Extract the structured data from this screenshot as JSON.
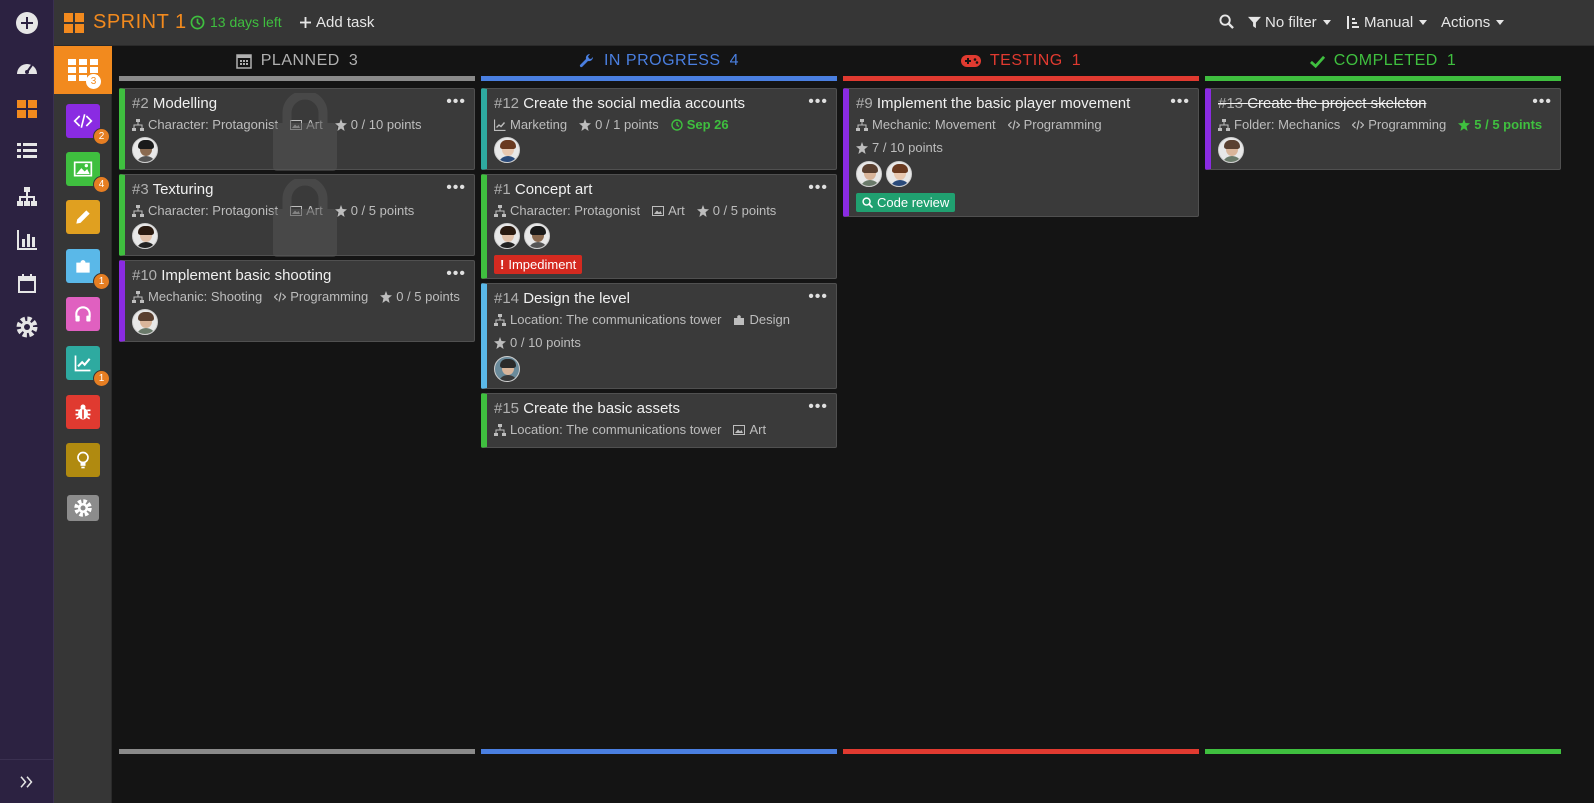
{
  "sprint": {
    "title": "SPRINT 1",
    "days_left": "13 days left",
    "add_task": "Add task"
  },
  "toolbar": {
    "filter": "No filter",
    "sort": "Manual",
    "actions": "Actions"
  },
  "project_badges": {
    "board": "3",
    "code": "2",
    "art": "4",
    "puzzle": "1",
    "chart": "1"
  },
  "columns": [
    {
      "label": "PLANNED",
      "count": "3",
      "color": "#8a8a8a"
    },
    {
      "label": "IN PROGRESS",
      "count": "4",
      "color": "#4a7fe0"
    },
    {
      "label": "TESTING",
      "count": "1",
      "color": "#e03a30"
    },
    {
      "label": "COMPLETED",
      "count": "1",
      "color": "#3fbf3f"
    }
  ],
  "cards": {
    "c2": {
      "num": "#2",
      "title": "Modelling",
      "category": "Character: Protagonist",
      "type": "Art",
      "points": "0 / 10 points",
      "color": "#3fbf3f"
    },
    "c3": {
      "num": "#3",
      "title": "Texturing",
      "category": "Character: Protagonist",
      "type": "Art",
      "points": "0 / 5 points",
      "color": "#3fbf3f"
    },
    "c10": {
      "num": "#10",
      "title": "Implement basic shooting",
      "category": "Mechanic: Shooting",
      "type": "Programming",
      "points": "0 / 5 points",
      "color": "#8a2be2"
    },
    "c12": {
      "num": "#12",
      "title": "Create the social media accounts",
      "type": "Marketing",
      "points": "0 / 1 points",
      "due": "Sep 26",
      "color": "#2eaaa0"
    },
    "c1": {
      "num": "#1",
      "title": "Concept art",
      "category": "Character: Protagonist",
      "type": "Art",
      "points": "0 / 5 points",
      "tag": "Impediment",
      "color": "#3fbf3f"
    },
    "c14": {
      "num": "#14",
      "title": "Design the level",
      "category": "Location: The communications tower",
      "type": "Design",
      "points": "0 / 10 points",
      "color": "#5ab8e8"
    },
    "c15": {
      "num": "#15",
      "title": "Create the basic assets",
      "category": "Location: The communications tower",
      "type": "Art",
      "color": "#3fbf3f"
    },
    "c9": {
      "num": "#9",
      "title": "Implement the basic player movement",
      "category": "Mechanic: Movement",
      "type": "Programming",
      "points": "7 / 10 points",
      "tag": "Code review",
      "color": "#8a2be2"
    },
    "c13": {
      "num": "#13",
      "title": "Create the project skeleton",
      "category": "Folder: Mechanics",
      "type": "Programming",
      "points": "5 / 5 points",
      "color": "#8a2be2"
    }
  },
  "menu_glyph": "•••"
}
